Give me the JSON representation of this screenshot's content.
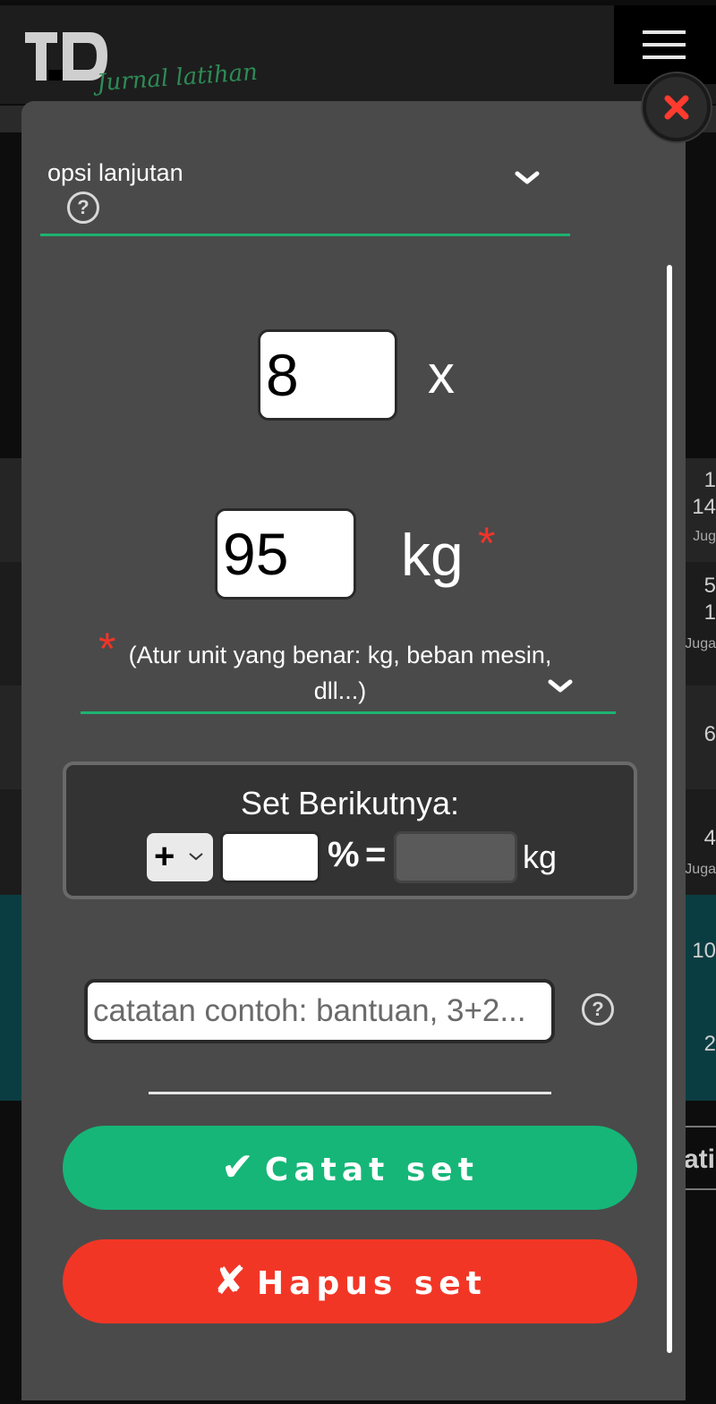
{
  "app": {
    "logo_text": "TD",
    "logo_subtitle": "Jurnal latihan"
  },
  "background_rows": [
    {
      "lines": [
        "1",
        "14",
        "Jug"
      ]
    },
    {
      "lines": [
        "5",
        "1",
        "Juga"
      ]
    },
    {
      "lines": [
        "6"
      ]
    },
    {
      "lines": [
        "4",
        "Juga"
      ]
    },
    {
      "lines": [
        "10"
      ]
    },
    {
      "lines": [
        "2"
      ]
    }
  ],
  "background_tab_fragment": "ati",
  "advanced": {
    "label": "opsi lanjutan",
    "help_icon": "question-circle-icon"
  },
  "set": {
    "reps": "8",
    "reps_unit": "x",
    "weight": "95",
    "weight_unit": "kg",
    "required_mark": "*",
    "unit_note": "(Atur unit yang benar: kg, beban mesin, dll...)"
  },
  "next_set": {
    "title": "Set Berikutnya:",
    "operator": "+",
    "percent": "",
    "percent_sign": "%",
    "equals": "=",
    "result": "",
    "result_unit": "kg"
  },
  "note": {
    "placeholder": "catatan contoh: bantuan, 3+2..."
  },
  "buttons": {
    "log_glyph": "✔",
    "log_label": "Catat set",
    "delete_glyph": "✘",
    "delete_label": "Hapus set"
  },
  "colors": {
    "accent_green": "#16b678",
    "danger_red": "#f23626",
    "modal_bg": "#4a4a4a",
    "underline_green": "#1db36f"
  }
}
